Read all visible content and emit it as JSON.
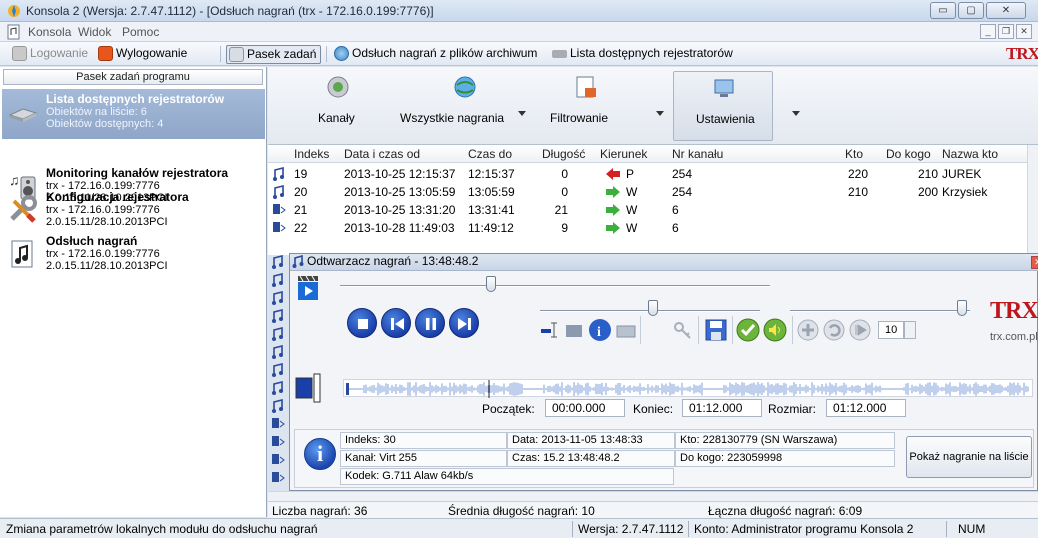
{
  "window": {
    "title": "Konsola 2 (Wersja:  2.7.47.1112) - [Odsłuch nagrań (trx - 172.16.0.199:7776)]",
    "btn_min": "▭",
    "btn_max": "▢",
    "btn_close": "✕"
  },
  "menu": {
    "items": [
      "Konsola",
      "Widok",
      "Pomoc"
    ],
    "mdi_min": "_",
    "mdi_restore": "❐",
    "mdi_close": "✕"
  },
  "toolbar": {
    "logowanie": "Logowanie",
    "wylogowanie": "Wylogowanie",
    "pasek_zadan": "Pasek zadań",
    "odsluch_archiwum": "Odsłuch nagrań z plików archiwum",
    "lista_rejestratorow": "Lista dostępnych rejestratorów",
    "logo_text": "TRX"
  },
  "left_panel": {
    "header": "Pasek zadań programu",
    "items": [
      {
        "title": "Lista dostępnych rejestratorów",
        "line1": "Obiektów na liście: 6",
        "line2": "Obiektów dostępnych: 4",
        "icon": "recorder-list-icon"
      },
      {
        "title": "Monitoring kanałów rejestratora",
        "line1": "trx - 172.16.0.199:7776",
        "line2": "2.0.15.11/28.10.2013PCI",
        "icon": "speaker-monitor-icon"
      },
      {
        "title": "Konfiguracja rejestratora",
        "line1": "trx - 172.16.0.199:7776",
        "line2": "2.0.15.11/28.10.2013PCI",
        "icon": "config-tools-icon"
      },
      {
        "title": "Odsłuch nagrań",
        "line1": "trx - 172.16.0.199:7776",
        "line2": "2.0.15.11/28.10.2013PCI",
        "icon": "music-note-icon"
      }
    ]
  },
  "ribbon": {
    "kanaly": "Kanały",
    "wszystkie": "Wszystkie nagrania",
    "filtrowanie": "Filtrowanie",
    "ustawienia": "Ustawienia"
  },
  "grid": {
    "headers": [
      "Indeks",
      "Data i czas od",
      "Czas do",
      "Długość",
      "Kierunek",
      "Nr kanału",
      "Kto",
      "Do kogo",
      "Nazwa kto"
    ],
    "rows": [
      {
        "indeks": "19",
        "od": "2013-10-25 12:15:37",
        "do": "12:15:37",
        "dlugosc": "0",
        "kierunek": "P",
        "dir": "in",
        "kanal": "254",
        "kto": "220",
        "dokogo": "210",
        "nazwa": "JUREK"
      },
      {
        "indeks": "20",
        "od": "2013-10-25 13:05:59",
        "do": "13:05:59",
        "dlugosc": "0",
        "kierunek": "W",
        "dir": "out",
        "kanal": "254",
        "kto": "210",
        "dokogo": "200",
        "nazwa": "Krzysiek"
      },
      {
        "indeks": "21",
        "od": "2013-10-25 13:31:20",
        "do": "13:31:41",
        "dlugosc": "21",
        "kierunek": "W",
        "dir": "out",
        "kanal": "6",
        "kto": "",
        "dokogo": "",
        "nazwa": ""
      },
      {
        "indeks": "22",
        "od": "2013-10-28 11:49:03",
        "do": "11:49:12",
        "dlugosc": "9",
        "kierunek": "W",
        "dir": "out",
        "kanal": "6",
        "kto": "",
        "dokogo": "",
        "nazwa": ""
      }
    ]
  },
  "player": {
    "title": "Odtwarzacz nagrań - 13:48:48.2",
    "close": "✕",
    "speed_value": "10",
    "site": "trx.com.pl",
    "logo_text": "TRX",
    "poczatek_label": "Początek:",
    "poczatek": "00:00.000",
    "koniec_label": "Koniec:",
    "koniec": "01:12.000",
    "rozmiar_label": "Rozmiar:",
    "rozmiar": "01:12.000",
    "info": {
      "indeks": "Indeks: 30",
      "kanal": "Kanał:  Virt 255",
      "kodek": "Kodek:  G.711 Alaw 64kb/s",
      "data": "Data:  2013-11-05 13:48:33",
      "czas": "Czas:  15.2  13:48:48.2",
      "kto": "Kto:  228130779  (SN Warszawa)",
      "dokogo": "Do kogo:  223059998"
    },
    "show_button": "Pokaż nagranie na liście",
    "info_glyph": "i"
  },
  "summary": {
    "liczba": "Liczba nagrań:  36",
    "srednia": "Średnia długość nagrań:  10",
    "laczna": "Łączna długość nagrań: 6:09"
  },
  "status": {
    "message": "Zmiana parametrów lokalnych modułu do odsłuchu nagrań",
    "wersja": "Wersja: 2.7.47.1112",
    "konto": "Konto: Administrator programu Konsola 2",
    "num": "NUM"
  },
  "colors": {
    "accent": "#1a3fa8",
    "selected": "#8ea6c9",
    "arrow_in": "#d42020",
    "arrow_out": "#3cb03c",
    "brand": "#c0151b"
  }
}
